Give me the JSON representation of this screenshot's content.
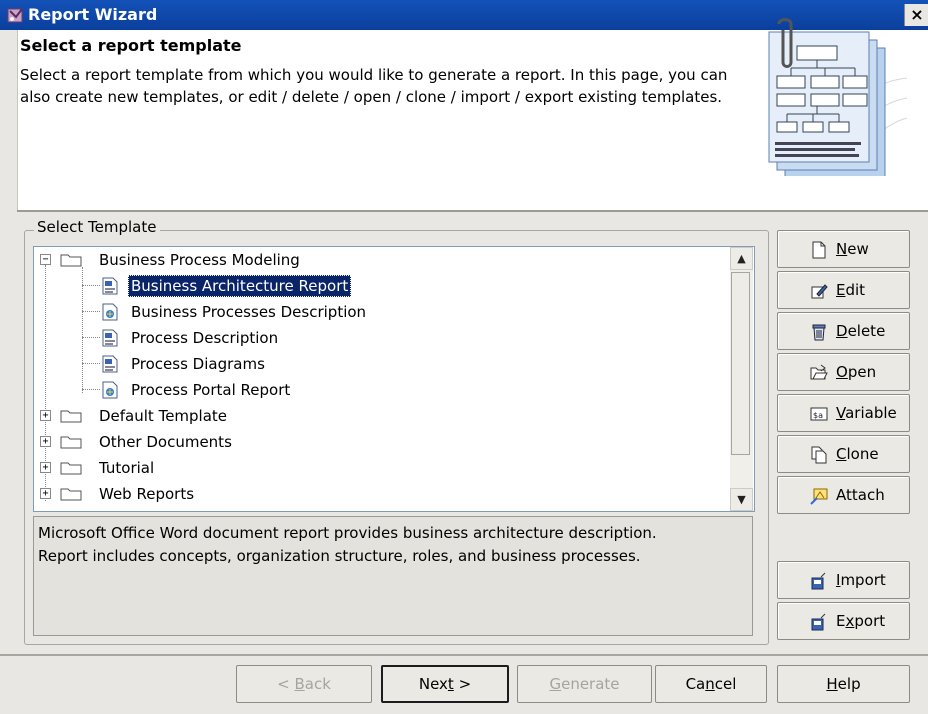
{
  "window": {
    "title": "Report Wizard",
    "close_glyph": "×"
  },
  "header": {
    "title": "Select a report template",
    "description": "Select a report template from which you would like to generate a report. In this page, you can also create new templates, or edit / delete / open / clone / import / export existing templates."
  },
  "group": {
    "label": "Select Template"
  },
  "tree": {
    "items": [
      {
        "label": "Business Process Modeling",
        "type": "folder",
        "expanded": true,
        "level": 0
      },
      {
        "label": "Business Architecture Report",
        "type": "word-template",
        "level": 1,
        "selected": true
      },
      {
        "label": "Business Processes Description",
        "type": "html-template",
        "level": 1
      },
      {
        "label": "Process Description",
        "type": "word-template",
        "level": 1
      },
      {
        "label": "Process Diagrams",
        "type": "word-template",
        "level": 1
      },
      {
        "label": "Process Portal Report",
        "type": "html-template",
        "level": 1
      },
      {
        "label": "Default Template",
        "type": "folder",
        "expanded": false,
        "level": 0
      },
      {
        "label": "Other Documents",
        "type": "folder",
        "expanded": false,
        "level": 0
      },
      {
        "label": "Tutorial",
        "type": "folder",
        "expanded": false,
        "level": 0
      },
      {
        "label": "Web Reports",
        "type": "folder",
        "expanded": false,
        "level": 0
      }
    ]
  },
  "description_panel": {
    "text_line1": "Microsoft Office Word document report provides business architecture description.",
    "text_line2": "Report includes concepts, organization structure, roles, and business processes."
  },
  "side_buttons": {
    "new": {
      "pre": "",
      "mn": "N",
      "post": "ew"
    },
    "edit": {
      "pre": "",
      "mn": "E",
      "post": "dit"
    },
    "delete": {
      "pre": "",
      "mn": "D",
      "post": "elete"
    },
    "open": {
      "pre": "",
      "mn": "O",
      "post": "pen"
    },
    "variable": {
      "pre": "",
      "mn": "V",
      "post": "ariable"
    },
    "clone": {
      "pre": "",
      "mn": "C",
      "post": "lone"
    },
    "attach": {
      "pre": "",
      "mn": "",
      "post": "Attach"
    },
    "import": {
      "pre": "",
      "mn": "I",
      "post": "mport"
    },
    "export": {
      "pre": "E",
      "mn": "x",
      "post": "port"
    }
  },
  "bottom_buttons": {
    "back": {
      "pre": "< ",
      "mn": "B",
      "post": "ack"
    },
    "next": {
      "pre": "Nex",
      "mn": "t",
      "post": " >"
    },
    "generate": {
      "pre": "",
      "mn": "G",
      "post": "enerate"
    },
    "cancel": {
      "pre": "Ca",
      "mn": "n",
      "post": "cel"
    },
    "help": {
      "pre": "",
      "mn": "H",
      "post": "elp"
    }
  },
  "colors": {
    "titlebar": "#0a3f9c",
    "selection": "#0a246a",
    "dialog_bg": "#e9e7e3"
  }
}
